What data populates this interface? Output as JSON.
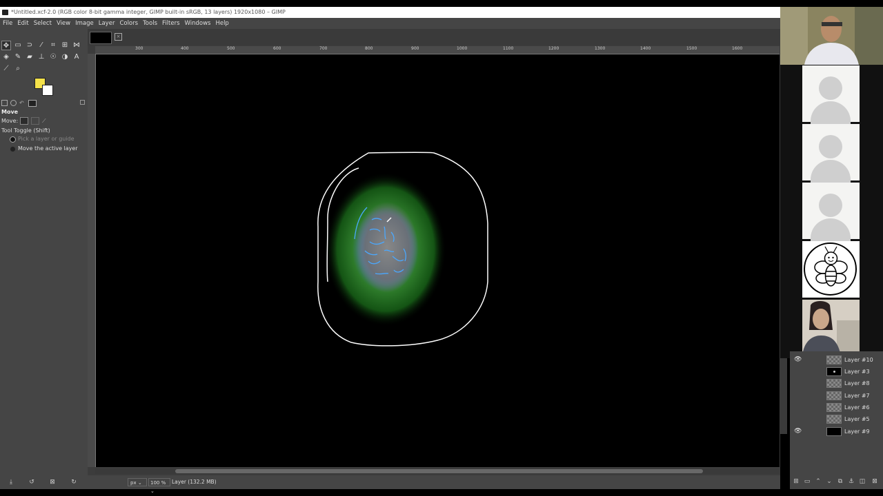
{
  "window": {
    "title": "*Untitled.xcf-2.0 (RGB color 8-bit gamma integer, GIMP built-in sRGB, 13 layers) 1920x1080 – GIMP"
  },
  "menu": [
    "File",
    "Edit",
    "Select",
    "View",
    "Image",
    "Layer",
    "Colors",
    "Tools",
    "Filters",
    "Windows",
    "Help"
  ],
  "ruler": {
    "h_ticks": [
      "300",
      "400",
      "500",
      "600",
      "700",
      "800",
      "900",
      "1000",
      "1100",
      "1200",
      "1300",
      "1400",
      "1500",
      "1600"
    ]
  },
  "colors": {
    "foreground": "#f5e24a",
    "background": "#ffffff"
  },
  "tool_options": {
    "title": "Move",
    "move_label": "Move:",
    "toggle_label": "Tool Toggle  (Shift)",
    "option_pick": "Pick a layer or guide",
    "option_move": "Move the active layer"
  },
  "status": {
    "unit": "px",
    "zoom": "100 %",
    "layer_info": "Layer (132.2 MB)"
  },
  "layers": [
    {
      "name": "Layer #10",
      "visible": true,
      "thumb": "checker"
    },
    {
      "name": "Layer #3",
      "visible": false,
      "thumb": "black-dot"
    },
    {
      "name": "Layer #8",
      "visible": false,
      "thumb": "checker"
    },
    {
      "name": "Layer #7",
      "visible": false,
      "thumb": "checker"
    },
    {
      "name": "Layer #6",
      "visible": false,
      "thumb": "checker"
    },
    {
      "name": "Layer #5",
      "visible": false,
      "thumb": "checker"
    },
    {
      "name": "Layer #9",
      "visible": true,
      "thumb": "black"
    }
  ],
  "participants": [
    {
      "type": "video",
      "icon": "participant-video-icon"
    },
    {
      "type": "avatar",
      "icon": "user-avatar-icon"
    },
    {
      "type": "avatar",
      "icon": "user-avatar-icon"
    },
    {
      "type": "avatar",
      "icon": "user-avatar-icon"
    },
    {
      "type": "image",
      "icon": "bee-icon"
    },
    {
      "type": "video",
      "icon": "participant-video-icon"
    }
  ]
}
